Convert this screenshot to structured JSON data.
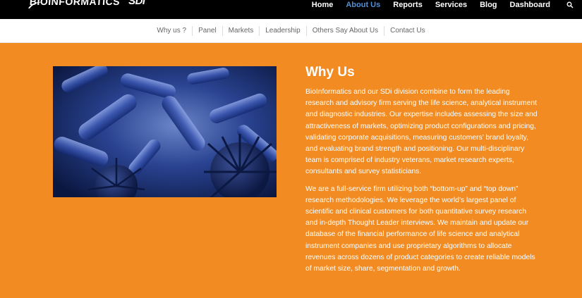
{
  "brand": {
    "logo_text": "BIOINFORMATICS",
    "sub_logo_text": "SDi"
  },
  "main_nav": {
    "items": [
      {
        "label": "Home"
      },
      {
        "label": "About Us"
      },
      {
        "label": "Reports"
      },
      {
        "label": "Services"
      },
      {
        "label": "Blog"
      },
      {
        "label": "Dashboard"
      }
    ],
    "active": "About Us",
    "search_icon": "search-icon"
  },
  "sub_nav": {
    "items": [
      {
        "label": "Why us ?"
      },
      {
        "label": "Panel"
      },
      {
        "label": "Markets"
      },
      {
        "label": "Leadership"
      },
      {
        "label": "Others Say About Us"
      },
      {
        "label": "Contact Us"
      }
    ]
  },
  "main": {
    "heading": "Why Us",
    "paragraphs": [
      "BioInformatics and our SDi division combine to form the leading research and advisory firm serving the life science, analytical instrument and diagnostic industries. Our expertise includes assessing the size and attractiveness of markets, optimizing product configurations and pricing, validating corporate acquisitions, measuring customers’ brand loyalty, and evaluating brand strength and positioning. Our multi-disciplinary team is comprised of industry veterans, market research experts, consultants and survey statisticians.",
      "We are a full-service firm utilizing both “bottom-up” and “top down” research methodologies. We leverage the world’s largest panel of scientific and clinical customers for both quantitative survey research and in-depth Thought Leader interviews. We maintain and update our database of the financial performance of life science and analytical instrument companies and use proprietary algorithms to allocate revenues across dozens of product categories to create reliable models of market size, share, segmentation and growth."
    ]
  },
  "colors": {
    "topbar": "#000000",
    "accent_orange": "#f28c22",
    "nav_active": "#4f8fd6",
    "text_on_orange": "#ffffff"
  }
}
